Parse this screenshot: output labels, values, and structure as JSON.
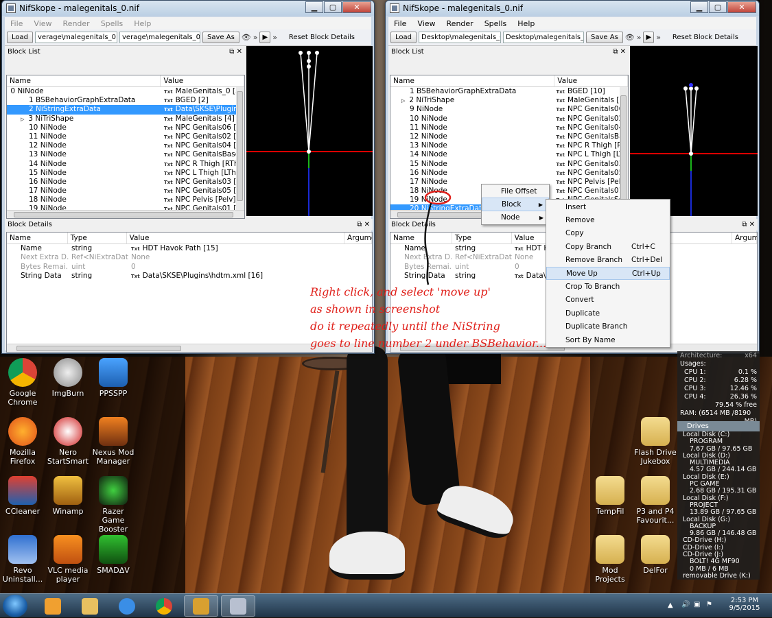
{
  "left_window": {
    "title": "NifSkope - malegenitals_0.nif",
    "menu": [
      "File",
      "View",
      "Render",
      "Spells",
      "Help"
    ],
    "toolbar": {
      "load": "Load",
      "path1": "verage\\malegenitals_0.nif",
      "path2": "verage\\malegenitals_0.nif",
      "save_as": "Save As",
      "reset": "Reset Block Details"
    },
    "block_list": {
      "title": "Block List",
      "col_name": "Name",
      "col_value": "Value",
      "rows": [
        {
          "name": "0 NiNode",
          "value": "MaleGenitals_0 [5]",
          "expand": "◢",
          "indent": 0
        },
        {
          "name": "1 BSBehaviorGraphExtraData",
          "value": "BGED [2]",
          "indent": 1
        },
        {
          "name": "2 NiStringExtraData",
          "value": "Data\\SKSE\\Plugins\\",
          "indent": 1,
          "selected": true
        },
        {
          "name": "3 NiTriShape",
          "value": "MaleGenitals [4]",
          "expand": "▷",
          "indent": 1
        },
        {
          "name": "10 NiNode",
          "value": "NPC Genitals06 [Ge",
          "indent": 1
        },
        {
          "name": "11 NiNode",
          "value": "NPC Genitals02 [Ge",
          "indent": 1
        },
        {
          "name": "12 NiNode",
          "value": "NPC Genitals04 [Ge",
          "indent": 1
        },
        {
          "name": "13 NiNode",
          "value": "NPC GenitalsBase [(",
          "indent": 1
        },
        {
          "name": "14 NiNode",
          "value": "NPC R Thigh [RThg",
          "indent": 1
        },
        {
          "name": "15 NiNode",
          "value": "NPC L Thigh [LThg]",
          "indent": 1
        },
        {
          "name": "16 NiNode",
          "value": "NPC Genitals03 [Ge",
          "indent": 1
        },
        {
          "name": "17 NiNode",
          "value": "NPC Genitals05 [Ge",
          "indent": 1
        },
        {
          "name": "18 NiNode",
          "value": "NPC Pelvis [Pelv] [1",
          "indent": 1
        },
        {
          "name": "19 NiNode",
          "value": "NPC Genitals01 [Ge",
          "indent": 1
        }
      ]
    },
    "block_details": {
      "title": "Block Details",
      "cols": [
        "Name",
        "Type",
        "Value",
        "Argume"
      ],
      "rows": [
        {
          "name": "Name",
          "type": "string",
          "value": "HDT Havok Path [15]",
          "txt": true
        },
        {
          "name": "Next Extra D...",
          "type": "Ref<NiExtraData>",
          "value": "None",
          "gray": true
        },
        {
          "name": "Bytes Remai...",
          "type": "uint",
          "value": "0",
          "gray": true
        },
        {
          "name": "String Data",
          "type": "string",
          "value": "Data\\SKSE\\Plugins\\hdtm.xml [16]",
          "txt": true
        }
      ]
    }
  },
  "right_window": {
    "title": "NifSkope - malegenitals_0.nif",
    "menu": [
      "File",
      "View",
      "Render",
      "Spells",
      "Help"
    ],
    "toolbar": {
      "load": "Load",
      "path1": "Desktop\\malegenitals_0.nif",
      "path2": "Desktop\\malegenitals_0.nif",
      "save_as": "Save As",
      "reset": "Reset Block Details"
    },
    "block_list": {
      "title": "Block List",
      "col_name": "Name",
      "col_value": "Value",
      "rows": [
        {
          "name": "1 BSBehaviorGraphExtraData",
          "value": "BGED [10]"
        },
        {
          "name": "2 NiTriShape",
          "value": "MaleGenitals [3]",
          "expand": "▷"
        },
        {
          "name": "9 NiNode",
          "value": "NPC Genitals06 ["
        },
        {
          "name": "10 NiNode",
          "value": "NPC Genitals02 ["
        },
        {
          "name": "11 NiNode",
          "value": "NPC Genitals04 ["
        },
        {
          "name": "12 NiNode",
          "value": "NPC GenitalsBas"
        },
        {
          "name": "13 NiNode",
          "value": "NPC R Thigh [RT"
        },
        {
          "name": "14 NiNode",
          "value": "NPC L Thigh [LT"
        },
        {
          "name": "15 NiNode",
          "value": "NPC Genitals03 ["
        },
        {
          "name": "16 NiNode",
          "value": "NPC Genitals05 ["
        },
        {
          "name": "17 NiNode",
          "value": "NPC Pelvis [Pelv"
        },
        {
          "name": "18 NiNode",
          "value": "NPC Genitals01 ["
        },
        {
          "name": "19 NiNode",
          "value": "NPC GenitalsScr"
        },
        {
          "name": "20 NiStringExtraData",
          "value": "Data\\SKSE\\Plugi",
          "selected": true
        }
      ]
    },
    "block_details": {
      "title": "Block Details",
      "cols": [
        "Name",
        "Type",
        "Value",
        "Argume"
      ],
      "rows": [
        {
          "name": "Name",
          "type": "string",
          "value": "HDT Ha",
          "txt": true
        },
        {
          "name": "Next Extra D...",
          "type": "Ref<NiExtraData>",
          "value": "None",
          "gray": true
        },
        {
          "name": "Bytes Remai...",
          "type": "uint",
          "value": "0",
          "gray": true
        },
        {
          "name": "String Data",
          "type": "string",
          "value": "Data\\SK",
          "txt": true
        }
      ]
    }
  },
  "context_menu": {
    "items": [
      {
        "label": "File Offset"
      },
      {
        "label": "Block",
        "submenu": true
      },
      {
        "label": "Node",
        "submenu": true
      }
    ]
  },
  "block_submenu": {
    "items": [
      {
        "label": "Insert",
        "shortcut": ""
      },
      {
        "label": "Remove",
        "shortcut": ""
      },
      {
        "label": "Copy",
        "shortcut": ""
      },
      {
        "label": "Copy Branch",
        "shortcut": "Ctrl+C"
      },
      {
        "label": "Remove Branch",
        "shortcut": "Ctrl+Del"
      },
      {
        "label": "Move Up",
        "shortcut": "Ctrl+Up",
        "highlight": true
      },
      {
        "label": "Crop To Branch",
        "shortcut": ""
      },
      {
        "label": "Convert",
        "shortcut": ""
      },
      {
        "label": "Duplicate",
        "shortcut": ""
      },
      {
        "label": "Duplicate Branch",
        "shortcut": ""
      },
      {
        "label": "Sort By Name",
        "shortcut": ""
      }
    ]
  },
  "annotation": {
    "lines": [
      "Right click, and select 'move up'",
      "as shown in screenshot",
      "do it repeatedly until the NiString",
      "goes to line number 2 under BSBehavior..."
    ],
    "color": "#e0201a"
  },
  "desktop_icons": [
    {
      "label": "Google Chrome",
      "icon": "chrome-icon"
    },
    {
      "label": "ImgBurn",
      "icon": "imgburn-icon"
    },
    {
      "label": "PPSSPP",
      "icon": "ppsspp-icon"
    },
    {
      "label": "Mozilla Firefox",
      "icon": "firefox-icon"
    },
    {
      "label": "Nero StartSmart",
      "icon": "nero-icon"
    },
    {
      "label": "Nexus Mod Manager",
      "icon": "nexus-icon"
    },
    {
      "label": "CCleaner",
      "icon": "ccleaner-icon"
    },
    {
      "label": "Winamp",
      "icon": "winamp-icon"
    },
    {
      "label": "Razer Game Booster",
      "icon": "razer-icon"
    },
    {
      "label": "Revo Uninstall...",
      "icon": "revo-icon"
    },
    {
      "label": "VLC media player",
      "icon": "vlc-icon"
    },
    {
      "label": "SMADΔV",
      "icon": "smadav-icon"
    },
    {
      "label": "Flash Drive Jukebox",
      "icon": "folder-icon"
    },
    {
      "label": "TempFil",
      "icon": "folder-icon"
    },
    {
      "label": "P3 and P4 Favourit...",
      "icon": "folder-icon"
    },
    {
      "label": "Mod Projects",
      "icon": "folder-icon"
    },
    {
      "label": "DelFor",
      "icon": "folder-icon"
    }
  ],
  "system_gadget": {
    "arch_label": "Architecture:",
    "arch_value": "x64",
    "usages": "Usages:",
    "cpus": [
      {
        "label": "CPU 1:",
        "value": "0.1 %"
      },
      {
        "label": "CPU 2:",
        "value": "6.28 %"
      },
      {
        "label": "CPU 3:",
        "value": "12.46 %"
      },
      {
        "label": "CPU 4:",
        "value": "26.36 %"
      }
    ],
    "free": "79.54 % free",
    "ram": "RAM: (6514 MB /8190",
    "ram2": "MB)"
  },
  "drives_gadget": {
    "title": "Drives",
    "lines": [
      {
        "text": "Local Disk (C:)",
        "ind": false
      },
      {
        "text": "PROGRAM",
        "ind": true
      },
      {
        "text": "7.67 GB / 97.65 GB",
        "ind": true
      },
      {
        "text": "Local Disk (D:)",
        "ind": false
      },
      {
        "text": "MULTIMEDIA",
        "ind": true
      },
      {
        "text": "4.57 GB / 244.14 GB",
        "ind": true
      },
      {
        "text": "Local Disk (E:)",
        "ind": false
      },
      {
        "text": "PC GAME",
        "ind": true
      },
      {
        "text": "2.68 GB / 195.31 GB",
        "ind": true
      },
      {
        "text": "Local Disk (F:)",
        "ind": false
      },
      {
        "text": "PROJECT",
        "ind": true
      },
      {
        "text": "13.89 GB / 97.65 GB",
        "ind": true
      },
      {
        "text": "Local Disk (G:)",
        "ind": false
      },
      {
        "text": "BACKUP",
        "ind": true
      },
      {
        "text": "9.86 GB / 146.48 GB",
        "ind": true
      },
      {
        "text": "CD-Drive (H:)",
        "ind": false
      },
      {
        "text": "CD-Drive (I:)",
        "ind": false
      },
      {
        "text": "CD-Drive (J:)",
        "ind": false
      },
      {
        "text": "BOLT! 4G MF90",
        "ind": true
      },
      {
        "text": "0 MB / 6 MB",
        "ind": true
      },
      {
        "text": "removable Drive (K:)",
        "ind": false
      }
    ]
  },
  "taskbar": {
    "time": "2:53 PM",
    "date": "9/5/2015"
  }
}
